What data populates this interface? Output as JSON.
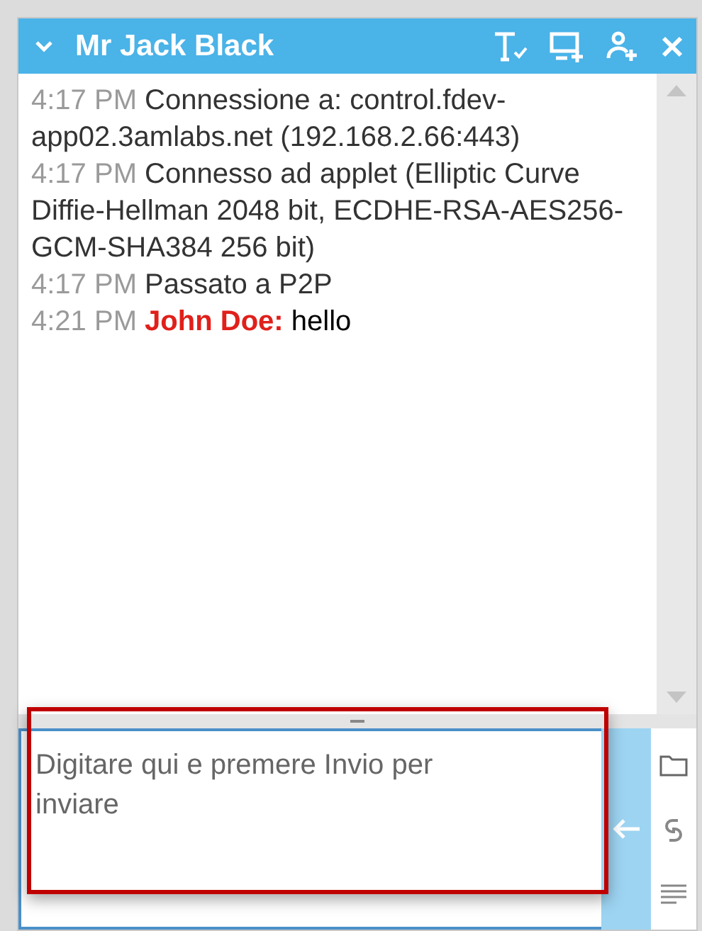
{
  "header": {
    "title": "Mr Jack Black",
    "expanded": true
  },
  "messages": [
    {
      "kind": "system",
      "time": "4:17 PM",
      "text": "Connessione a: control.fdev-app02.3amlabs.net (192.168.2.66:443)"
    },
    {
      "kind": "system",
      "time": "4:17 PM",
      "text": "Connesso ad applet (Elliptic Curve Diffie-Hellman 2048 bit, ECDHE-RSA-AES256-GCM-SHA384 256 bit)"
    },
    {
      "kind": "system",
      "time": "4:17 PM",
      "text": "Passato a P2P"
    },
    {
      "kind": "chat",
      "time": "4:21 PM",
      "sender": "John Doe:",
      "text": "hello"
    }
  ],
  "composer": {
    "placeholder": "Digitare qui e premere Invio per inviare"
  }
}
